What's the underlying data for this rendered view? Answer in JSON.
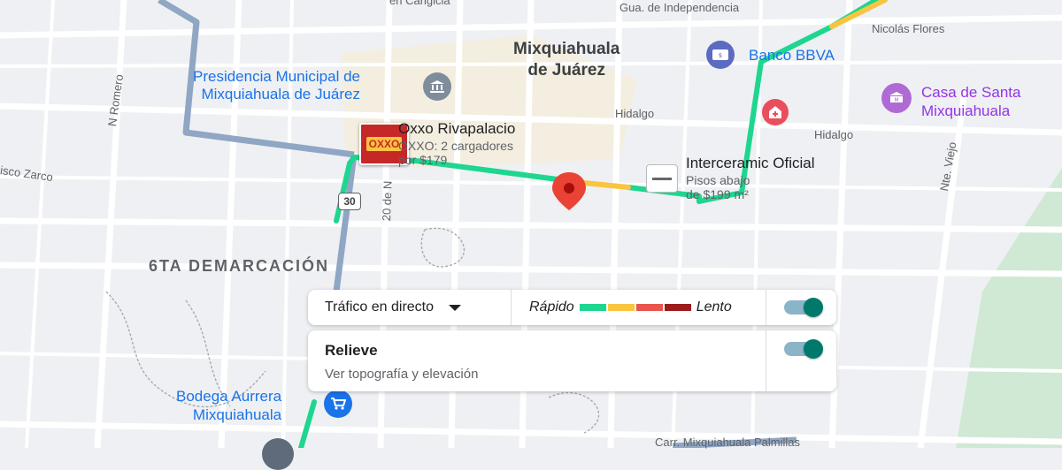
{
  "map": {
    "town": [
      "Mixquiahuala",
      "de Juárez"
    ],
    "district": "6TA DEMARCACIÓN",
    "route_shield": "30",
    "streets": {
      "top_left": "en Carigicia",
      "independencia": "Gua. de Independencia",
      "nicolas_flores": "Nicolás Flores",
      "hidalgo_1": "Hidalgo",
      "hidalgo_2": "Hidalgo",
      "n_romero": "N Romero",
      "zarco": "isco Zarco",
      "nte_viejo": "Nte. Viejo",
      "twenty_nov": "20 de N",
      "bottom": "Carr. Mixquiahuala Palmillas"
    },
    "places": {
      "presidencia": [
        "Presidencia Municipal de",
        "Mixquiahuala de Juárez"
      ],
      "banco": "Banco BBVA",
      "casa": [
        "Casa de Santa",
        "Mixquiahuala"
      ],
      "oxxo": {
        "name": "Oxxo Rivapalacio",
        "desc": [
          "OXXO: 2 cargadores",
          "por $179"
        ],
        "logo": "OXXO"
      },
      "interceramic": {
        "name": "Interceramic Oficial",
        "desc": [
          "Pisos abajo",
          "de $199 m²"
        ]
      },
      "bodega": [
        "Bodega Aurrera",
        "Mixquiahuala"
      ]
    },
    "icons": [
      "government-icon",
      "bank-icon",
      "hospital-icon",
      "museum-icon",
      "shopping-cart-icon",
      "location-pin-icon"
    ]
  },
  "traffic_panel": {
    "label": "Tráfico en directo",
    "fast_label": "Rápido",
    "slow_label": "Lento",
    "legend_colors": [
      "#1ed68f",
      "#f9c440",
      "#e8554c",
      "#9b1c1c"
    ],
    "toggle_on": true
  },
  "terrain_panel": {
    "title": "Relieve",
    "subtitle": "Ver topografía y elevación",
    "toggle_on": true
  },
  "colors": {
    "traffic_green": "#1ed68f",
    "traffic_yellow": "#f9c440",
    "main_road": "#8fa6c4",
    "park": "#cfe9d4"
  }
}
